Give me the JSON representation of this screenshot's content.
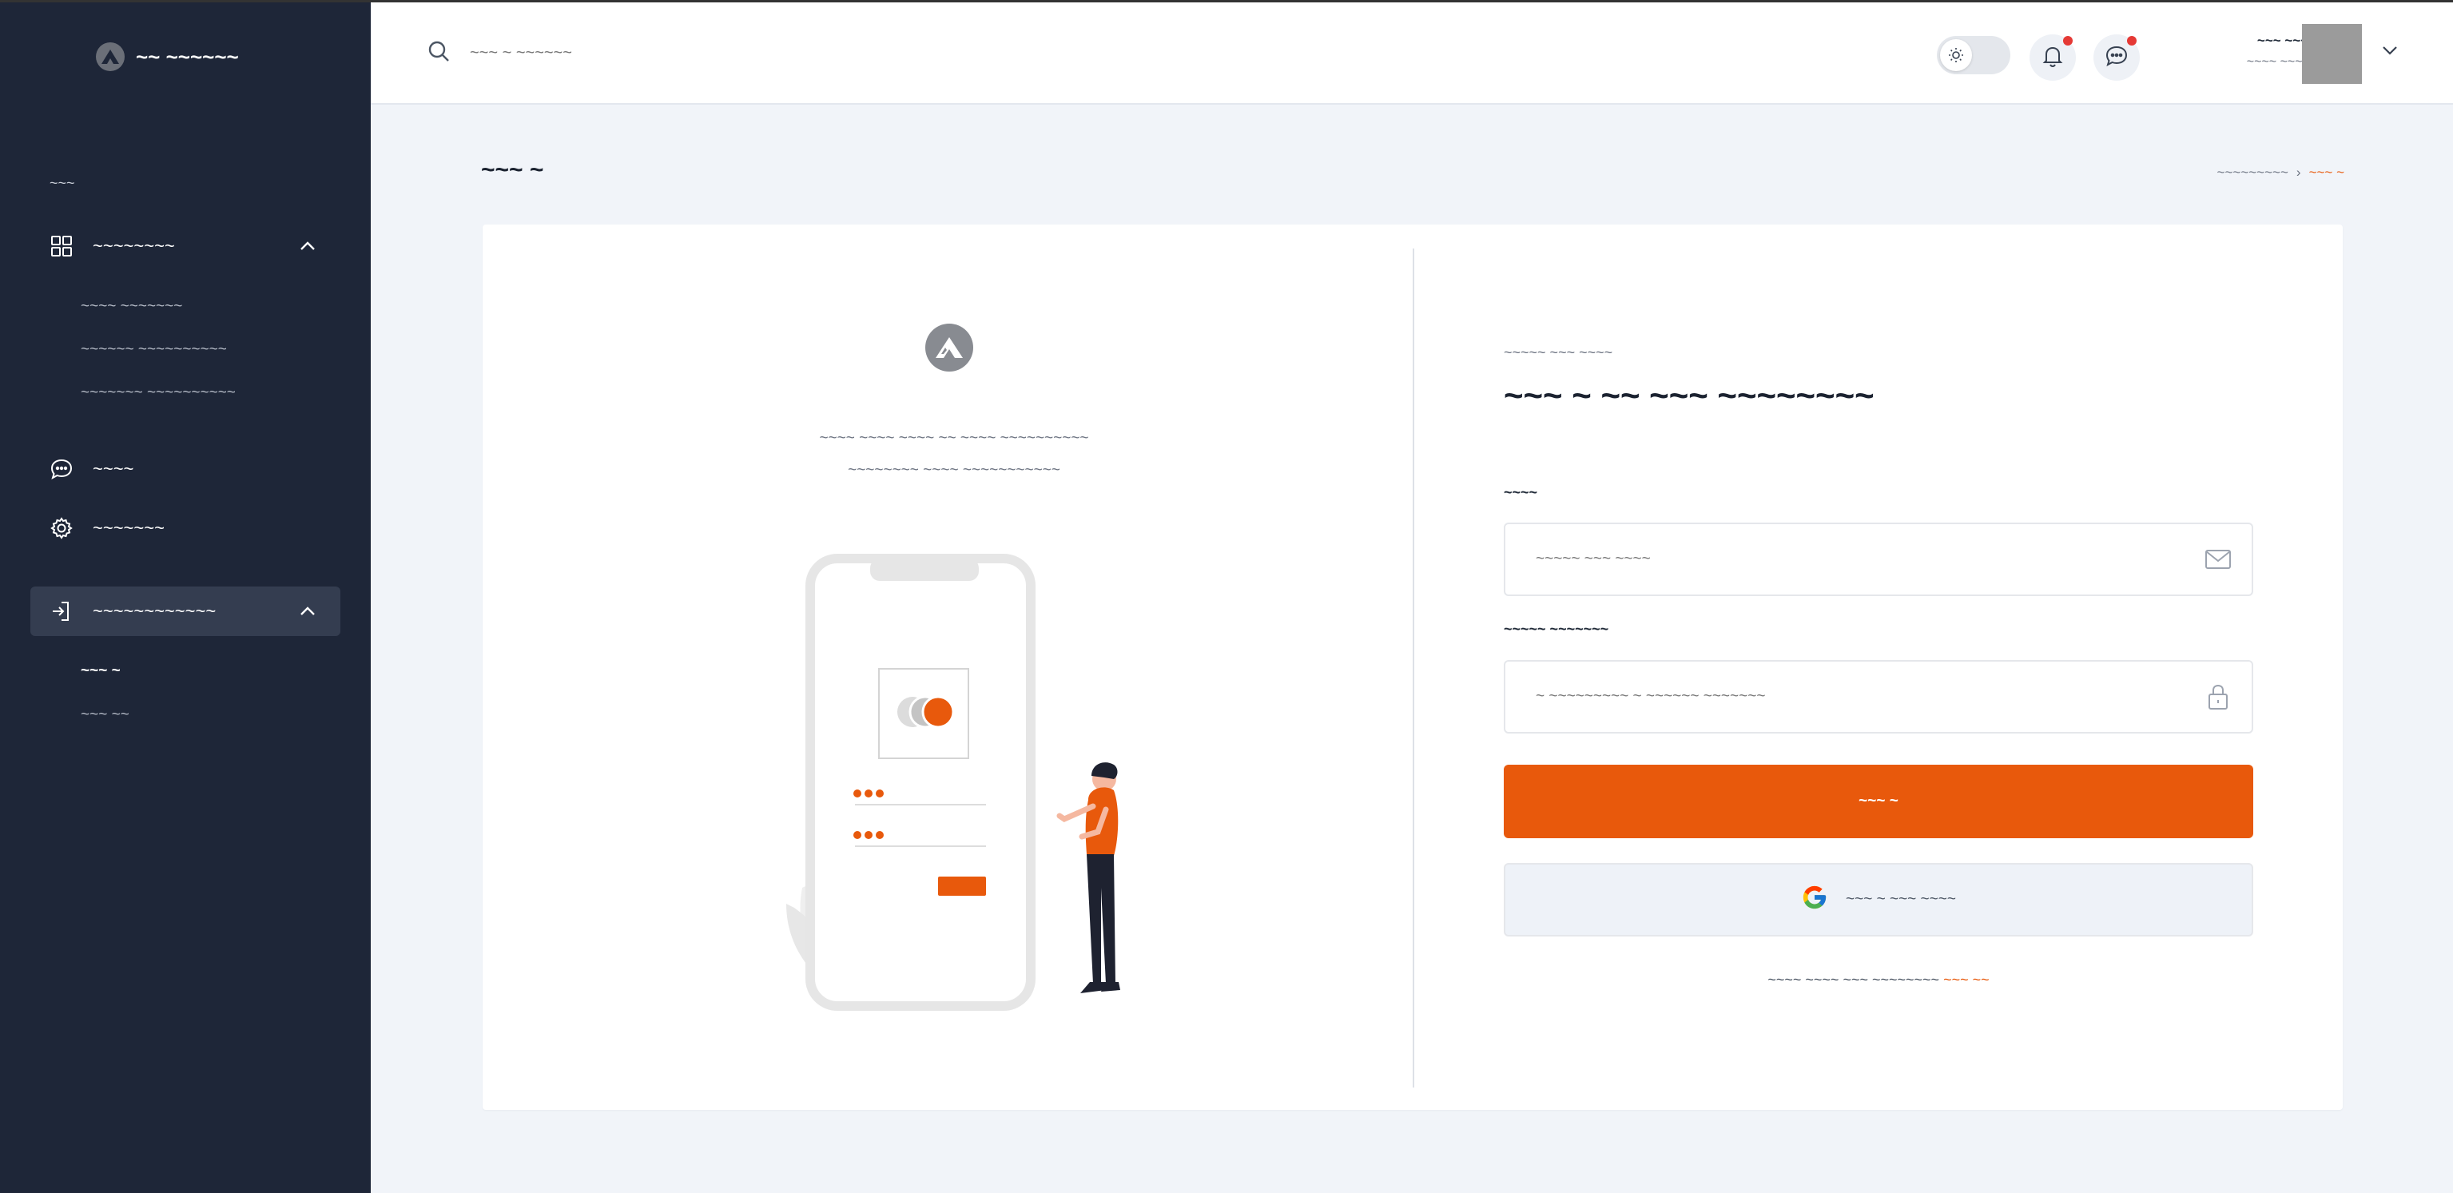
{
  "app": {
    "brand_name": "~~ ~~~~~~"
  },
  "sidebar": {
    "section_label": "~~~",
    "dashboards": {
      "label": "~~~~~~~~",
      "children": [
        "~~~~ ~~~~~~~",
        "~~~~~~ ~~~~~~~~~~",
        "~~~~~~~ ~~~~~~~~~~"
      ]
    },
    "chat": {
      "label": "~~~~"
    },
    "settings": {
      "label": "~~~~~~~"
    },
    "auth": {
      "label": "~~~~~~~~~~~~",
      "children": [
        "~~~ ~",
        "~~~ ~~"
      ]
    }
  },
  "header": {
    "search_placeholder": "~~~ ~ ~~~~~~",
    "user_name": "~~~ ~~~~~~",
    "user_role": "~~~~ ~~~~~~~"
  },
  "page": {
    "title": "~~~ ~",
    "breadcrumb": [
      "~~~~~~~~~",
      "~~~ ~"
    ],
    "breadcrumb_sep": "›"
  },
  "login": {
    "tagline_1": "~~~~ ~~~~ ~~~~ ~~ ~~~~ ~~~~~~~~~~",
    "tagline_2": "~~~~~~~~ ~~~~ ~~~~~~~~~~~",
    "eyebrow": "~~~~~ ~~~ ~~~~",
    "heading": "~~~ ~ ~~ ~~~ ~~~~~~~~",
    "email_label": "~~~~",
    "email_placeholder": "~~~~~ ~~~ ~~~~",
    "password_label": "~~~~~ ~~~~~~~",
    "password_placeholder": "~ ~~~~~~~~~ ~ ~~~~~~ ~~~~~~~",
    "submit_label": "~~~ ~",
    "google_label": "~~~ ~ ~~~ ~~~~",
    "signup_text": "~~~~ ~~~~ ~~~ ~~~~~~~~",
    "signup_link": "~~~ ~~"
  },
  "colors": {
    "accent": "#e8590c",
    "sidebar_bg": "#1e2638",
    "page_bg": "#f1f4f9"
  }
}
